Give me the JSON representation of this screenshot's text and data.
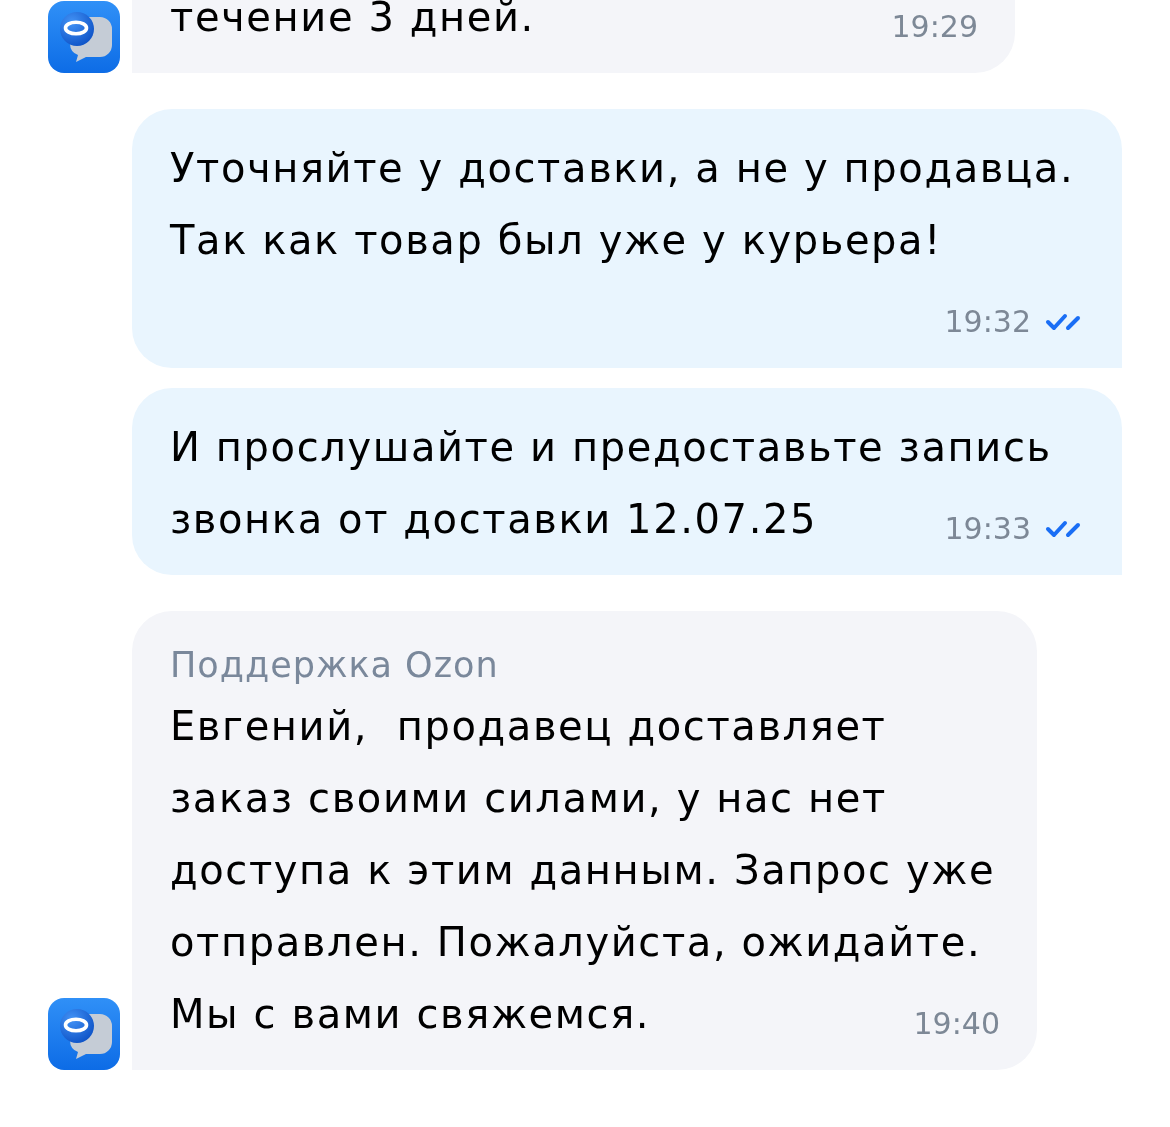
{
  "messages": [
    {
      "kind": "incoming",
      "text": "течение 3 дней.",
      "time": "19:29"
    },
    {
      "kind": "outgoing",
      "text": "Уточняйте у доставки, а не у продавца. Так как товар был уже у курьера!",
      "time": "19:32",
      "read": true
    },
    {
      "kind": "outgoing",
      "text": "И прослушайте и предоставьте запись звонка от доставки 12.07.25",
      "time": "19:33",
      "read": true
    },
    {
      "kind": "incoming",
      "sender": "Поддержка Ozon",
      "text": "Евгений,  продавец доставляет заказ своими силами, у нас нет доступа к этим данным. Запрос уже отправлен. Пожалуйста, ожидайте. Мы с вами свяжемся.",
      "time": "19:40"
    }
  ]
}
